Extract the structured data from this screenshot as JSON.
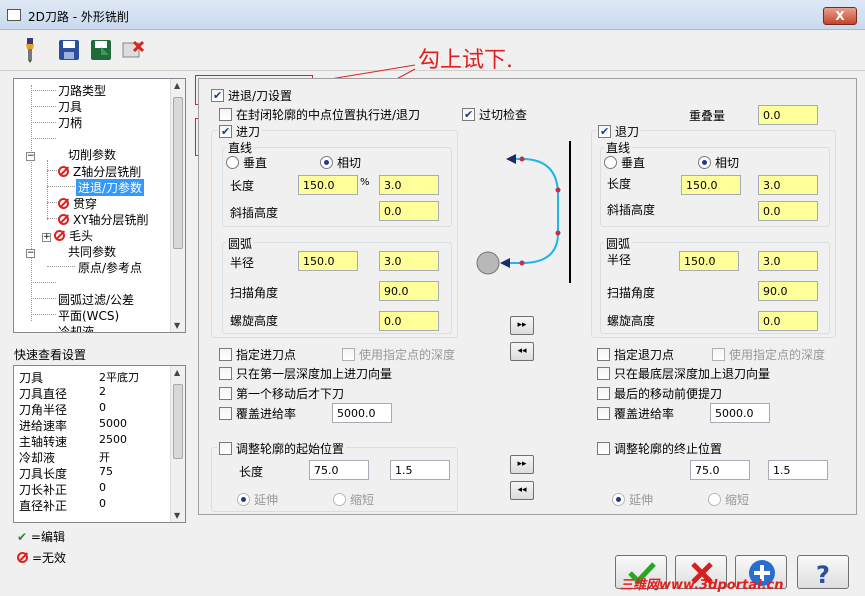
{
  "window": {
    "title": "2D刀路 - 外形铣削",
    "close_glyph": "X"
  },
  "annotation": {
    "text": "勾上试下."
  },
  "tree": {
    "items": [
      {
        "label": "刀路类型"
      },
      {
        "label": "刀具"
      },
      {
        "label": "刀柄"
      },
      {
        "label": ""
      },
      {
        "label": "切削参数"
      },
      {
        "label": "Z轴分层铣削"
      },
      {
        "label": "进退/刀参数"
      },
      {
        "label": "贯穿"
      },
      {
        "label": "XY轴分层铣削"
      },
      {
        "label": "毛头"
      },
      {
        "label": "共同参数"
      },
      {
        "label": "原点/参考点"
      },
      {
        "label": ""
      },
      {
        "label": "圆弧过滤/公差"
      },
      {
        "label": "平面(WCS)"
      },
      {
        "label": "冷却液"
      }
    ]
  },
  "quickview": {
    "title": "快速查看设置",
    "rows": [
      {
        "k": "刀具",
        "v": "2平底刀"
      },
      {
        "k": "刀具直径",
        "v": "2"
      },
      {
        "k": "刀角半径",
        "v": "0"
      },
      {
        "k": "进给速率",
        "v": "5000"
      },
      {
        "k": "主轴转速",
        "v": "2500"
      },
      {
        "k": "冷却液",
        "v": "开"
      },
      {
        "k": "刀具长度",
        "v": "75"
      },
      {
        "k": "刀长补正",
        "v": "0"
      },
      {
        "k": "直径补正",
        "v": "0"
      }
    ]
  },
  "legend": {
    "edit": "=编辑",
    "invalid": "=无效"
  },
  "main": {
    "entry_exit": {
      "label": "进退/刀设置",
      "checked": true
    },
    "closed_contour_midpoint": {
      "label": "在封闭轮廓的中点位置执行进/退刀"
    },
    "overlap_check": {
      "label": "过切检查"
    },
    "overlap": {
      "label": "重叠量",
      "value": "0.0"
    },
    "entry": {
      "label": "进刀",
      "line_title": "直线",
      "perpendicular": "垂直",
      "tangent": "相切",
      "length_label": "长度",
      "length_value": "150.0",
      "percent": "%",
      "length_abs": "3.0",
      "ramp_label": "斜插高度",
      "ramp_value": "0.0",
      "arc_title": "圆弧",
      "radius_label": "半径",
      "radius_value": "150.0",
      "radius_abs": "3.0",
      "sweep_label": "扫描角度",
      "sweep_value": "90.0",
      "helix_label": "螺旋高度",
      "helix_value": "0.0",
      "use_point": "指定进刀点",
      "use_point_depth": "使用指定点的深度",
      "first_depth_only": "只在第一层深度加上进刀向量",
      "plunge_after_first": "第一个移动后才下刀",
      "override_feed": "覆盖进给率",
      "override_feed_value": "5000.0",
      "adjust_contour_start": "调整轮廓的起始位置",
      "adjust_length_label": "长度",
      "adjust_length_value": "75.0",
      "adjust_length_abs": "1.5",
      "extend": "延伸",
      "shorten": "缩短"
    },
    "exit": {
      "label": "退刀",
      "line_title": "直线",
      "perpendicular": "垂直",
      "tangent": "相切",
      "length_label": "长度",
      "length_value": "150.0",
      "length_abs": "3.0",
      "ramp_label": "斜插高度",
      "ramp_value": "0.0",
      "arc_title": "圆弧",
      "radius_label": "半径",
      "radius_value": "150.0",
      "radius_abs": "3.0",
      "sweep_label": "扫描角度",
      "sweep_value": "90.0",
      "helix_label": "螺旋高度",
      "helix_value": "0.0",
      "use_point": "指定退刀点",
      "use_point_depth": "使用指定点的深度",
      "last_depth_only": "只在最底层深度加上退刀向量",
      "retract_before_last": "最后的移动前便提刀",
      "override_feed": "覆盖进给率",
      "override_feed_value": "5000.0",
      "adjust_contour_end": "调整轮廓的终止位置",
      "adjust_length_value": "75.0",
      "adjust_length_abs": "1.5",
      "extend": "延伸",
      "shorten": "缩短"
    },
    "copy_right": "▸▸",
    "copy_left": "◂◂"
  },
  "watermark": "三维网www.3dportal.cn",
  "colors": {
    "accent": "#3399ff",
    "field": "#ffff99",
    "annotation": "#e02020"
  }
}
